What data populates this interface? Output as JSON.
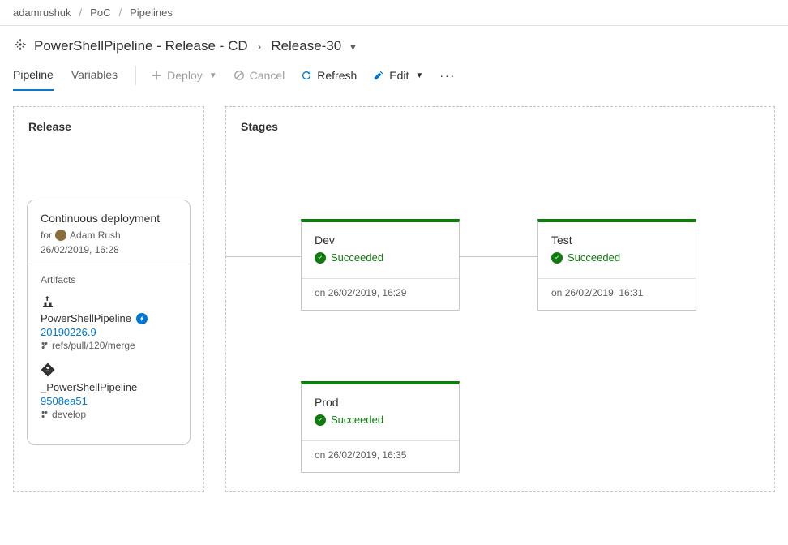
{
  "breadcrumb": {
    "org": "adamrushuk",
    "project": "PoC",
    "section": "Pipelines"
  },
  "header": {
    "pipeline_name": "PowerShellPipeline - Release - CD",
    "release_name": "Release-30"
  },
  "tabs": {
    "pipeline": "Pipeline",
    "variables": "Variables"
  },
  "toolbar": {
    "deploy": "Deploy",
    "cancel": "Cancel",
    "refresh": "Refresh",
    "edit": "Edit"
  },
  "release_panel": {
    "title": "Release",
    "card_title": "Continuous deployment",
    "for_label": "for",
    "user": "Adam Rush",
    "date": "26/02/2019, 16:28",
    "artifacts_label": "Artifacts",
    "artifacts": [
      {
        "name": "PowerShellPipeline",
        "version": "20190226.9",
        "branch": "refs/pull/120/merge",
        "type": "build"
      },
      {
        "name": "_PowerShellPipeline",
        "version": "9508ea51",
        "branch": "develop",
        "type": "repo"
      }
    ]
  },
  "stages_panel": {
    "title": "Stages",
    "succeeded_label": "Succeeded",
    "on_prefix": "on",
    "stages": [
      {
        "name": "Dev",
        "timestamp": "26/02/2019, 16:29"
      },
      {
        "name": "Test",
        "timestamp": "26/02/2019, 16:31"
      },
      {
        "name": "Prod",
        "timestamp": "26/02/2019, 16:35"
      }
    ]
  }
}
